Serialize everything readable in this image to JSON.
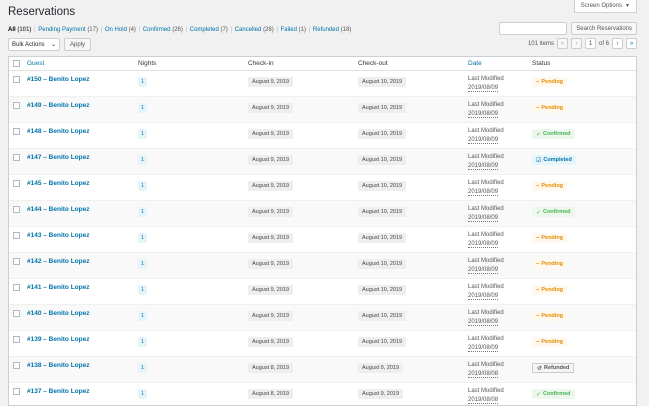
{
  "screen_options": {
    "label": "Screen Options"
  },
  "page": {
    "title": "Reservations"
  },
  "filters": [
    {
      "label": "All",
      "count": "(101)",
      "current": true
    },
    {
      "label": "Pending Payment",
      "count": "(17)"
    },
    {
      "label": "On Hold",
      "count": "(4)"
    },
    {
      "label": "Confirmed",
      "count": "(26)"
    },
    {
      "label": "Completed",
      "count": "(7)"
    },
    {
      "label": "Cancelled",
      "count": "(28)"
    },
    {
      "label": "Failed",
      "count": "(1)"
    },
    {
      "label": "Refunded",
      "count": "(18)"
    }
  ],
  "search": {
    "placeholder": "",
    "button": "Search Reservations"
  },
  "bulk": {
    "selected": "Bulk Actions",
    "apply": "Apply"
  },
  "pagination": {
    "items": "101 items",
    "first": "«",
    "prev": "‹",
    "current": "1",
    "of": "of 6",
    "next": "›",
    "last": "»"
  },
  "columns": {
    "guest": "Guest",
    "nights": "Nights",
    "checkin": "Check-in",
    "checkout": "Check-out",
    "date": "Date",
    "status": "Status"
  },
  "rows": [
    {
      "guest": "#150 – Benito Lopez",
      "nights": "1",
      "checkin": "August 9, 2019",
      "checkout": "August 10, 2019",
      "modified_label": "Last Modified",
      "modified_date": "2019/08/09",
      "status": "Pending",
      "status_type": "pending"
    },
    {
      "guest": "#149 – Benito Lopez",
      "nights": "1",
      "checkin": "August 9, 2019",
      "checkout": "August 10, 2019",
      "modified_label": "Last Modified",
      "modified_date": "2019/08/09",
      "status": "Pending",
      "status_type": "pending"
    },
    {
      "guest": "#148 – Benito Lopez",
      "nights": "1",
      "checkin": "August 9, 2019",
      "checkout": "August 10, 2019",
      "modified_label": "Last Modified",
      "modified_date": "2019/08/09",
      "status": "Confirmed",
      "status_type": "confirmed"
    },
    {
      "guest": "#147 – Benito Lopez",
      "nights": "1",
      "checkin": "August 9, 2019",
      "checkout": "August 10, 2019",
      "modified_label": "Last Modified",
      "modified_date": "2019/08/09",
      "status": "Completed",
      "status_type": "completed"
    },
    {
      "guest": "#145 – Benito Lopez",
      "nights": "1",
      "checkin": "August 9, 2019",
      "checkout": "August 10, 2019",
      "modified_label": "Last Modified",
      "modified_date": "2019/08/09",
      "status": "Pending",
      "status_type": "pending"
    },
    {
      "guest": "#144 – Benito Lopez",
      "nights": "1",
      "checkin": "August 9, 2019",
      "checkout": "August 10, 2019",
      "modified_label": "Last Modified",
      "modified_date": "2019/08/09",
      "status": "Confirmed",
      "status_type": "confirmed"
    },
    {
      "guest": "#143 – Benito Lopez",
      "nights": "1",
      "checkin": "August 9, 2019",
      "checkout": "August 10, 2019",
      "modified_label": "Last Modified",
      "modified_date": "2019/08/09",
      "status": "Pending",
      "status_type": "pending"
    },
    {
      "guest": "#142 – Benito Lopez",
      "nights": "1",
      "checkin": "August 9, 2019",
      "checkout": "August 10, 2019",
      "modified_label": "Last Modified",
      "modified_date": "2019/08/09",
      "status": "Pending",
      "status_type": "pending"
    },
    {
      "guest": "#141 – Benito Lopez",
      "nights": "1",
      "checkin": "August 9, 2019",
      "checkout": "August 10, 2019",
      "modified_label": "Last Modified",
      "modified_date": "2019/08/09",
      "status": "Pending",
      "status_type": "pending"
    },
    {
      "guest": "#140 – Benito Lopez",
      "nights": "1",
      "checkin": "August 9, 2019",
      "checkout": "August 10, 2019",
      "modified_label": "Last Modified",
      "modified_date": "2019/08/09",
      "status": "Pending",
      "status_type": "pending"
    },
    {
      "guest": "#139 – Benito Lopez",
      "nights": "1",
      "checkin": "August 9, 2019",
      "checkout": "August 10, 2019",
      "modified_label": "Last Modified",
      "modified_date": "2019/08/09",
      "status": "Pending",
      "status_type": "pending"
    },
    {
      "guest": "#138 – Benito Lopez",
      "nights": "1",
      "checkin": "August 8, 2019",
      "checkout": "August 9, 2019",
      "modified_label": "Last Modified",
      "modified_date": "2019/08/08",
      "status": "Refunded",
      "status_type": "refunded"
    },
    {
      "guest": "#137 – Benito Lopez",
      "nights": "1",
      "checkin": "August 8, 2019",
      "checkout": "August 9, 2019",
      "modified_label": "Last Modified",
      "modified_date": "2019/08/08",
      "status": "Confirmed",
      "status_type": "confirmed"
    }
  ],
  "status_icons": {
    "pending": "–",
    "confirmed": "✓",
    "completed": "☑",
    "refunded": "↺"
  },
  "colors": {
    "link": "#0073aa",
    "pending": "#e48d00",
    "confirmed": "#46b450",
    "completed": "#0073aa"
  }
}
